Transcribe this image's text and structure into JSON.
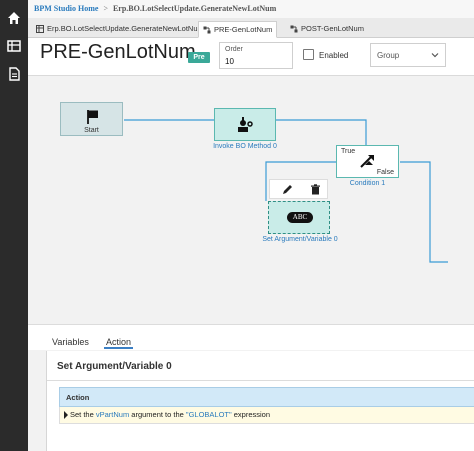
{
  "sidebar": {
    "items": [
      {
        "icon": "home-icon"
      },
      {
        "icon": "grid-icon"
      },
      {
        "icon": "document-icon"
      }
    ]
  },
  "breadcrumb": {
    "home": "BPM Studio Home",
    "separator": ">",
    "current": "Erp.BO.LotSelectUpdate.GenerateNewLotNum"
  },
  "tabs": [
    {
      "label": "Erp.BO.LotSelectUpdate.GenerateNewLotNum"
    },
    {
      "label": "PRE-GenLotNum"
    },
    {
      "label": "POST-GenLotNum"
    }
  ],
  "header": {
    "title": "PRE-GenLotNum",
    "badge": "Pre",
    "order_label": "Order",
    "order_value": "10",
    "enabled_label": "Enabled",
    "group_placeholder": "Group"
  },
  "workflow": {
    "start_label": "Start",
    "invoke_label": "Invoke BO Method 0",
    "condition_label": "Condition 1",
    "condition_true": "True",
    "condition_false": "False",
    "setarg_label": "Set Argument/Variable 0",
    "setarg_text": "ABC"
  },
  "bottom": {
    "tabs": [
      {
        "label": "Variables"
      },
      {
        "label": "Action"
      }
    ],
    "panel_title": "Set Argument/Variable 0",
    "table_header": "Action",
    "row": {
      "pre": "Set the ",
      "variable": "vPartNum",
      "mid": " argument to the ",
      "literal": "\"GLOBALOT\"",
      "post": " expression"
    }
  },
  "colors": {
    "accent_teal": "#3aa898",
    "link_blue": "#2a7bbd",
    "node_fill": "#c9ece8",
    "sidebar": "#2b2b2b"
  }
}
